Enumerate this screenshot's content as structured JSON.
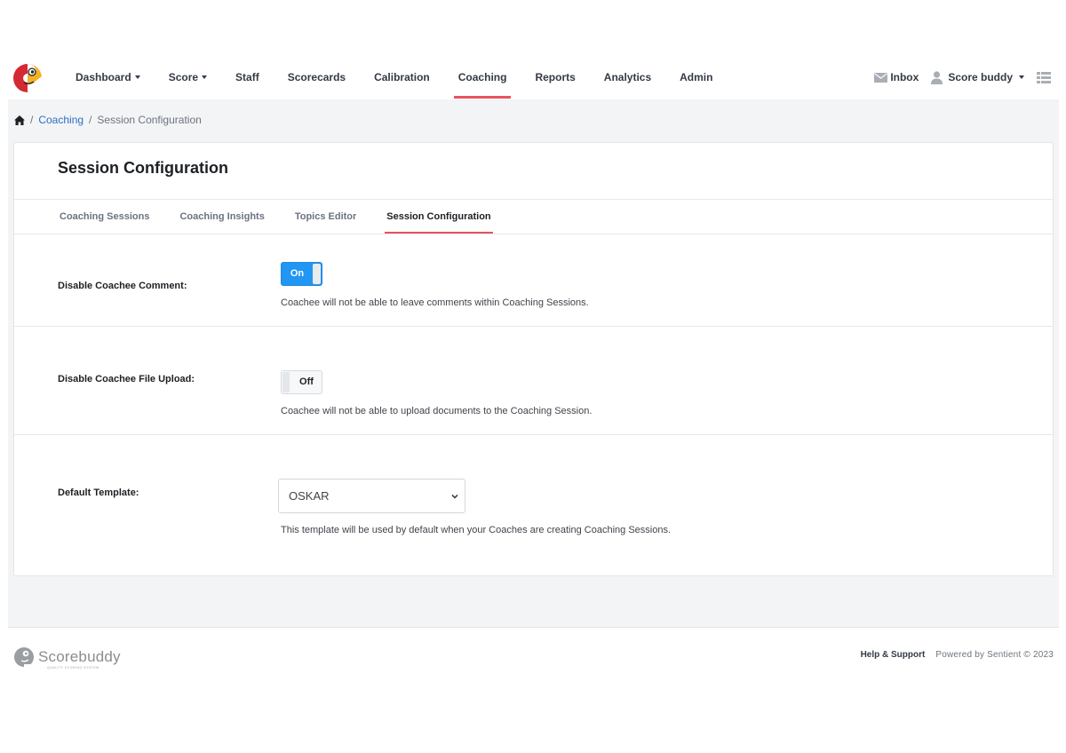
{
  "nav": {
    "logo": "scorebuddy-parrot-logo",
    "items": [
      {
        "label": "Dashboard",
        "dropdown": true,
        "active": false
      },
      {
        "label": "Score",
        "dropdown": true,
        "active": false
      },
      {
        "label": "Staff",
        "dropdown": false,
        "active": false
      },
      {
        "label": "Scorecards",
        "dropdown": false,
        "active": false
      },
      {
        "label": "Calibration",
        "dropdown": false,
        "active": false
      },
      {
        "label": "Coaching",
        "dropdown": false,
        "active": true
      },
      {
        "label": "Reports",
        "dropdown": false,
        "active": false
      },
      {
        "label": "Analytics",
        "dropdown": false,
        "active": false
      },
      {
        "label": "Admin",
        "dropdown": false,
        "active": false
      }
    ],
    "inbox_label": "Inbox",
    "user_label": "Score buddy",
    "accent_color": "#e8525e"
  },
  "breadcrumb": {
    "home_icon": "home-icon",
    "items": [
      "Coaching",
      "Session Configuration"
    ]
  },
  "page": {
    "title": "Session Configuration",
    "tabs": [
      {
        "label": "Coaching Sessions",
        "active": false
      },
      {
        "label": "Coaching Insights",
        "active": false
      },
      {
        "label": "Topics Editor",
        "active": false
      },
      {
        "label": "Session Configuration",
        "active": true
      }
    ]
  },
  "settings": {
    "disable_comment": {
      "label": "Disable Coachee Comment:",
      "toggle_state": "On",
      "help": "Coachee will not be able to leave comments within Coaching Sessions."
    },
    "disable_upload": {
      "label": "Disable Coachee File Upload:",
      "toggle_state": "Off",
      "help": "Coachee will not be able to upload documents to the Coaching Session."
    },
    "default_template": {
      "label": "Default Template:",
      "selected": "OSKAR",
      "help": "This template will be used by default when your Coaches are creating Coaching Sessions."
    },
    "toggle_on_color": "#2196f3"
  },
  "footer": {
    "brand": "Scorebuddy",
    "tagline": "QUALITY SCORING SYSTEM",
    "help_label": "Help & Support",
    "powered": "Powered by Sentient © 2023"
  }
}
